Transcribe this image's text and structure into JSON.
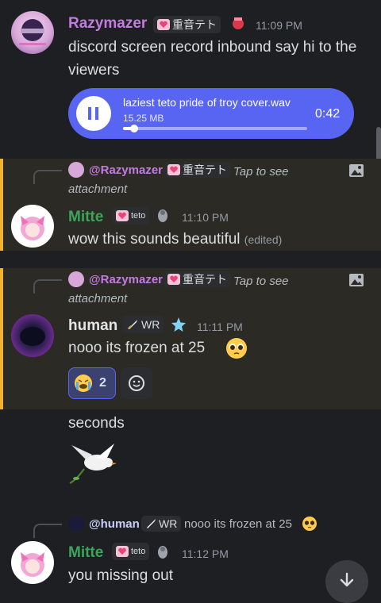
{
  "colors": {
    "background": "#1e1f22",
    "highlight": "#2c2a25",
    "accent": "#f0b232",
    "audio": "#5865f2",
    "razymazer": "#c27be0",
    "mitte": "#3ba55c",
    "human": "#e3e5e8"
  },
  "msg1": {
    "user": "Razymazer",
    "tag": "重音テト",
    "time": "11:09 PM",
    "text": "discord screen record inbound say hi to the viewers",
    "audio": {
      "filename": "laziest teto pride of troy cover.wav",
      "size": "15.25 MB",
      "duration": "0:42",
      "progress": 0.06
    }
  },
  "msg2": {
    "reply_user": "@Razymazer",
    "reply_tag": "重音テト",
    "reply_text": "Tap to see attachment",
    "user": "Mitte",
    "tag": "teto",
    "time": "11:10 PM",
    "text": "wow this sounds beautiful",
    "edited": "(edited)"
  },
  "msg3": {
    "reply_user": "@Razymazer",
    "reply_tag": "重音テト",
    "reply_text": "Tap to see attachment",
    "user": "human",
    "tag": "WR",
    "time": "11:11 PM",
    "text": "nooo its  frozen at 25",
    "reaction_count": "2"
  },
  "msg4": {
    "text": "seconds"
  },
  "msg5": {
    "reply_user": "@human",
    "reply_tag": "WR",
    "reply_text": "nooo its  frozen at 25",
    "user": "Mitte",
    "tag": "teto",
    "time": "11:12 PM",
    "text": "you missing out"
  },
  "icons": [
    "heart-icon",
    "image-icon",
    "pause-icon",
    "dove-emoji",
    "pleading-emoji",
    "crying-emoji",
    "add-reaction-icon",
    "arrow-down-icon",
    "sword-icon",
    "star-badge-icon",
    "dog-badge-icon",
    "bow-badge-icon"
  ]
}
